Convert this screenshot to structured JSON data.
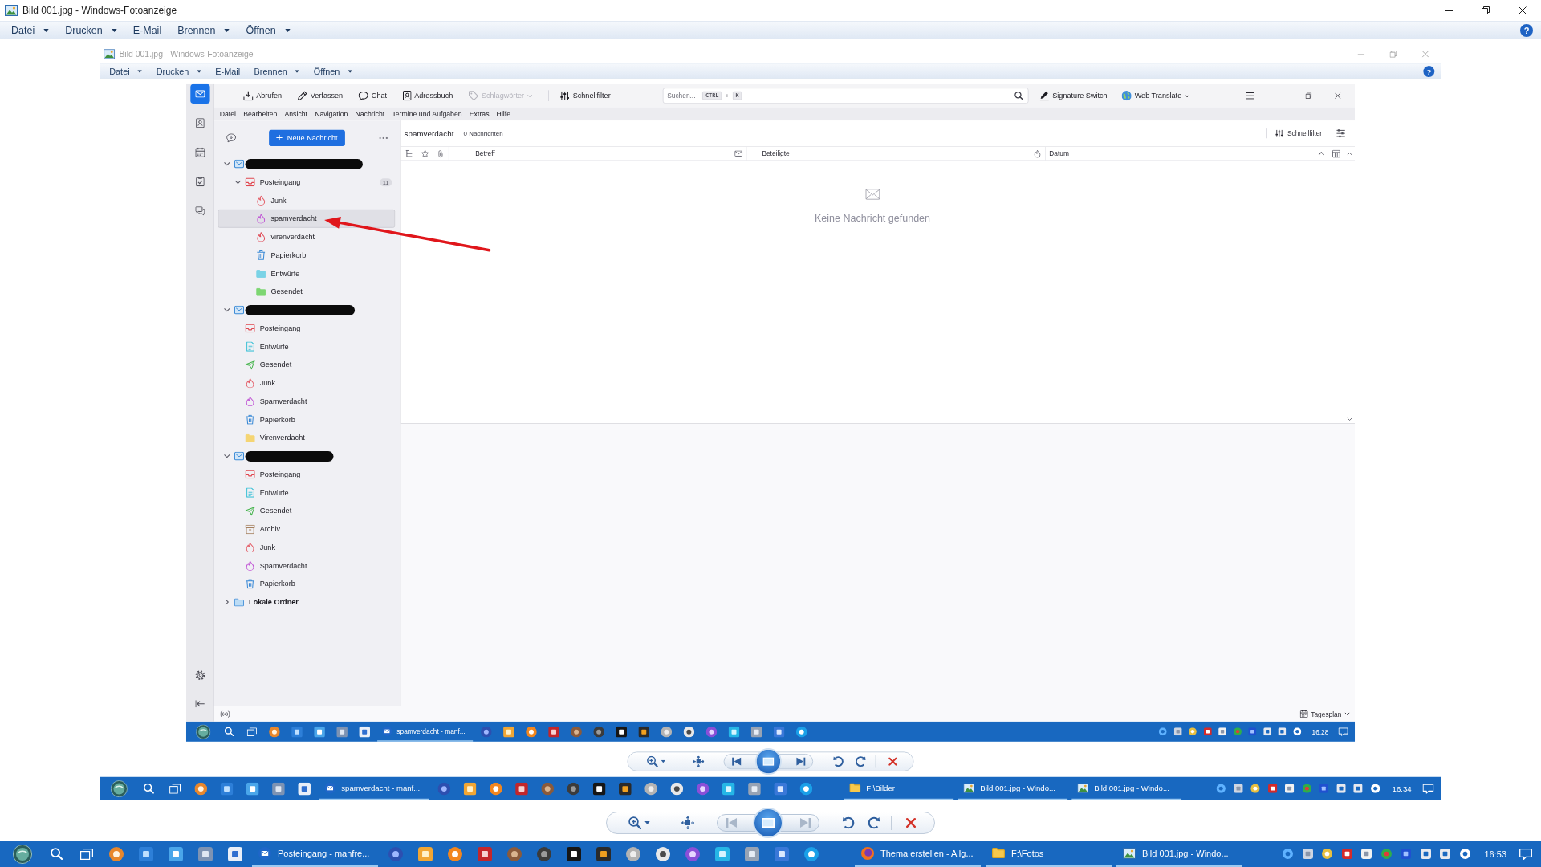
{
  "window": {
    "title": "Bild 001.jpg - Windows-Fotoanzeige",
    "active": true
  },
  "menu": {
    "items": [
      {
        "label": "Datei",
        "dropdown": true
      },
      {
        "label": "Drucken",
        "dropdown": true
      },
      {
        "label": "E-Mail",
        "dropdown": false
      },
      {
        "label": "Brennen",
        "dropdown": true
      },
      {
        "label": "Öffnen",
        "dropdown": true
      }
    ],
    "help": "?"
  },
  "screenshot": {
    "window": {
      "title": "Bild 001.jpg - Windows-Fotoanzeige",
      "active": false
    },
    "menu": {
      "items": [
        {
          "label": "Datei",
          "dropdown": true
        },
        {
          "label": "Drucken",
          "dropdown": true
        },
        {
          "label": "E-Mail",
          "dropdown": false
        },
        {
          "label": "Brennen",
          "dropdown": true
        },
        {
          "label": "Öffnen",
          "dropdown": true
        }
      ],
      "help": "?"
    },
    "screenshot": {
      "mail": {
        "spaces": [
          {
            "kind": "mail",
            "selected": true
          },
          {
            "kind": "contacts",
            "selected": false
          },
          {
            "kind": "calendar",
            "selected": false
          },
          {
            "kind": "tasks",
            "selected": false
          },
          {
            "kind": "chat",
            "selected": false
          }
        ],
        "toolbar": [
          {
            "kind": "fetch",
            "label": "Abrufen",
            "disabled": false,
            "dropdown": false
          },
          {
            "kind": "compose",
            "label": "Verfassen",
            "disabled": false,
            "dropdown": false
          },
          {
            "kind": "chat",
            "label": "Chat",
            "disabled": false,
            "dropdown": false
          },
          {
            "kind": "contacts",
            "label": "Adressbuch",
            "disabled": false,
            "dropdown": false
          },
          {
            "kind": "tags",
            "label": "Schlagwörter",
            "disabled": true,
            "dropdown": true
          },
          {
            "kind": "separator"
          },
          {
            "kind": "filter",
            "label": "Schnellfilter",
            "disabled": false,
            "dropdown": false
          }
        ],
        "search": {
          "placeholder": "Suchen...",
          "shortcut": [
            {
              "kind": "key",
              "text": "CTRL"
            },
            {
              "kind": "plus",
              "text": "+"
            },
            {
              "kind": "key",
              "text": "K"
            }
          ]
        },
        "addons": [
          {
            "kind": "signature",
            "label": "Signature Switch",
            "dropdown": false
          },
          {
            "kind": "translate",
            "label": "Web Translate",
            "dropdown": true
          }
        ],
        "menu": [
          "Datei",
          "Bearbeiten",
          "Ansicht",
          "Navigation",
          "Nachricht",
          "Termine und Aufgaben",
          "Extras",
          "Hilfe"
        ],
        "new_message": "Neue Nachricht",
        "folders": [
          {
            "kind": "account",
            "redacted": true,
            "expanded": true,
            "selected": false,
            "children": [
              {
                "kind": "inbox",
                "name": "Posteingang",
                "badge": "11",
                "expanded": true,
                "selected": false,
                "children": [
                  {
                    "kind": "junk",
                    "name": "Junk",
                    "selected": false
                  },
                  {
                    "kind": "spam",
                    "name": "spamverdacht",
                    "selected": true
                  },
                  {
                    "kind": "virus",
                    "name": "virenverdacht",
                    "selected": false
                  },
                  {
                    "kind": "trash",
                    "name": "Papierkorb",
                    "selected": false
                  },
                  {
                    "kind": "folder",
                    "name": "Entwürfe",
                    "color": "#7ad3e6",
                    "selected": false
                  },
                  {
                    "kind": "folder",
                    "name": "Gesendet",
                    "color": "#7dd672",
                    "selected": false
                  }
                ]
              }
            ]
          },
          {
            "kind": "account",
            "redacted": true,
            "expanded": true,
            "selected": false,
            "children": [
              {
                "kind": "inbox",
                "name": "Posteingang",
                "selected": false
              },
              {
                "kind": "drafts",
                "name": "Entwürfe",
                "selected": false
              },
              {
                "kind": "sent",
                "name": "Gesendet",
                "selected": false
              },
              {
                "kind": "junk",
                "name": "Junk",
                "selected": false
              },
              {
                "kind": "spam",
                "name": "Spamverdacht",
                "selected": false
              },
              {
                "kind": "trash",
                "name": "Papierkorb",
                "selected": false
              },
              {
                "kind": "folder",
                "name": "Virenverdacht",
                "color": "#f5d573",
                "selected": false
              }
            ]
          },
          {
            "kind": "account",
            "redacted": true,
            "expanded": true,
            "selected": false,
            "children": [
              {
                "kind": "inbox",
                "name": "Posteingang",
                "selected": false
              },
              {
                "kind": "drafts",
                "name": "Entwürfe",
                "selected": false
              },
              {
                "kind": "sent",
                "name": "Gesendet",
                "selected": false
              },
              {
                "kind": "archive",
                "name": "Archiv",
                "selected": false
              },
              {
                "kind": "junk",
                "name": "Junk",
                "selected": false
              },
              {
                "kind": "spam",
                "name": "Spamverdacht",
                "selected": false
              },
              {
                "kind": "trash",
                "name": "Papierkorb",
                "selected": false
              }
            ]
          },
          {
            "kind": "local",
            "name": "Lokale Ordner",
            "redacted": false,
            "expanded": false,
            "selected": false
          }
        ],
        "header": {
          "folder": "spamverdacht",
          "count": "0 Nachrichten",
          "quick_filter": "Schnellfilter"
        },
        "columns": [
          {
            "kind": "thread"
          },
          {
            "kind": "star"
          },
          {
            "kind": "attachment"
          },
          {
            "kind": "text",
            "label": "Betreff",
            "sorted": false
          },
          {
            "kind": "unread"
          },
          {
            "kind": "text",
            "label": "Beteiligte",
            "sorted": false
          },
          {
            "kind": "junk"
          },
          {
            "kind": "text",
            "label": "Datum",
            "sorted": true
          }
        ],
        "empty": "Keine Nachricht gefunden",
        "status": {
          "today_pane": "Tagesplan"
        }
      },
      "taskbar": {
        "pinned": [
          {
            "kind": "app"
          },
          {
            "kind": "app"
          },
          {
            "kind": "app"
          },
          {
            "kind": "app"
          },
          {
            "kind": "app"
          },
          {
            "kind": "mail",
            "label": "spamverdacht - manf..."
          },
          {
            "kind": "app"
          },
          {
            "kind": "app"
          },
          {
            "kind": "app"
          },
          {
            "kind": "app"
          },
          {
            "kind": "app"
          },
          {
            "kind": "app"
          },
          {
            "kind": "app"
          },
          {
            "kind": "app"
          },
          {
            "kind": "app"
          },
          {
            "kind": "app"
          },
          {
            "kind": "app"
          },
          {
            "kind": "app"
          },
          {
            "kind": "app"
          },
          {
            "kind": "app"
          },
          {
            "kind": "app"
          }
        ],
        "clock": "16:28"
      }
    },
    "toolbar": [
      {
        "kind": "zoom",
        "disabled": false
      },
      {
        "kind": "fit",
        "disabled": false
      },
      {
        "kind": "previous",
        "disabled": false
      },
      {
        "kind": "slideshow",
        "disabled": false
      },
      {
        "kind": "next",
        "disabled": false
      },
      {
        "kind": "counterclockwise",
        "disabled": false
      },
      {
        "kind": "clockwise",
        "disabled": false
      },
      {
        "kind": "delete",
        "disabled": false
      }
    ],
    "taskbar": {
      "pinned": [
        {
          "kind": "app"
        },
        {
          "kind": "app"
        },
        {
          "kind": "app"
        },
        {
          "kind": "app"
        },
        {
          "kind": "app"
        },
        {
          "kind": "mail",
          "label": "spamverdacht - manf..."
        },
        {
          "kind": "app"
        },
        {
          "kind": "app"
        },
        {
          "kind": "app"
        },
        {
          "kind": "app"
        },
        {
          "kind": "app"
        },
        {
          "kind": "app"
        },
        {
          "kind": "app"
        },
        {
          "kind": "app"
        },
        {
          "kind": "app"
        },
        {
          "kind": "app"
        },
        {
          "kind": "app"
        },
        {
          "kind": "app"
        },
        {
          "kind": "app"
        },
        {
          "kind": "app"
        },
        {
          "kind": "app"
        }
      ],
      "windows": [
        {
          "kind": "explorer",
          "label": "F:\\Bilder"
        },
        {
          "kind": "viewer",
          "label": "Bild 001.jpg - Windo..."
        },
        {
          "kind": "viewer",
          "label": "Bild 001.jpg - Windo..."
        }
      ],
      "clock": "16:34"
    }
  },
  "toolbar": [
    {
      "kind": "zoom",
      "disabled": false
    },
    {
      "kind": "fit",
      "disabled": false
    },
    {
      "kind": "previous",
      "disabled": true
    },
    {
      "kind": "slideshow",
      "disabled": false
    },
    {
      "kind": "next",
      "disabled": true
    },
    {
      "kind": "counterclockwise",
      "disabled": false
    },
    {
      "kind": "clockwise",
      "disabled": false
    },
    {
      "kind": "delete",
      "disabled": false
    }
  ],
  "taskbar": {
    "pinned": [
      {
        "kind": "app"
      },
      {
        "kind": "app"
      },
      {
        "kind": "app"
      },
      {
        "kind": "app"
      },
      {
        "kind": "app"
      },
      {
        "kind": "mail",
        "label": "Posteingang - manfre..."
      },
      {
        "kind": "app"
      },
      {
        "kind": "app"
      },
      {
        "kind": "app"
      },
      {
        "kind": "app"
      },
      {
        "kind": "app"
      },
      {
        "kind": "app"
      },
      {
        "kind": "app"
      },
      {
        "kind": "app"
      },
      {
        "kind": "app"
      },
      {
        "kind": "app"
      },
      {
        "kind": "app"
      },
      {
        "kind": "app"
      },
      {
        "kind": "app"
      },
      {
        "kind": "app"
      },
      {
        "kind": "app"
      }
    ],
    "windows": [
      {
        "kind": "browser",
        "label": "Thema erstellen - Allg..."
      },
      {
        "kind": "explorer",
        "label": "F:\\Fotos"
      },
      {
        "kind": "viewer",
        "label": "Bild 001.jpg - Windo..."
      }
    ],
    "clock": "16:53"
  }
}
